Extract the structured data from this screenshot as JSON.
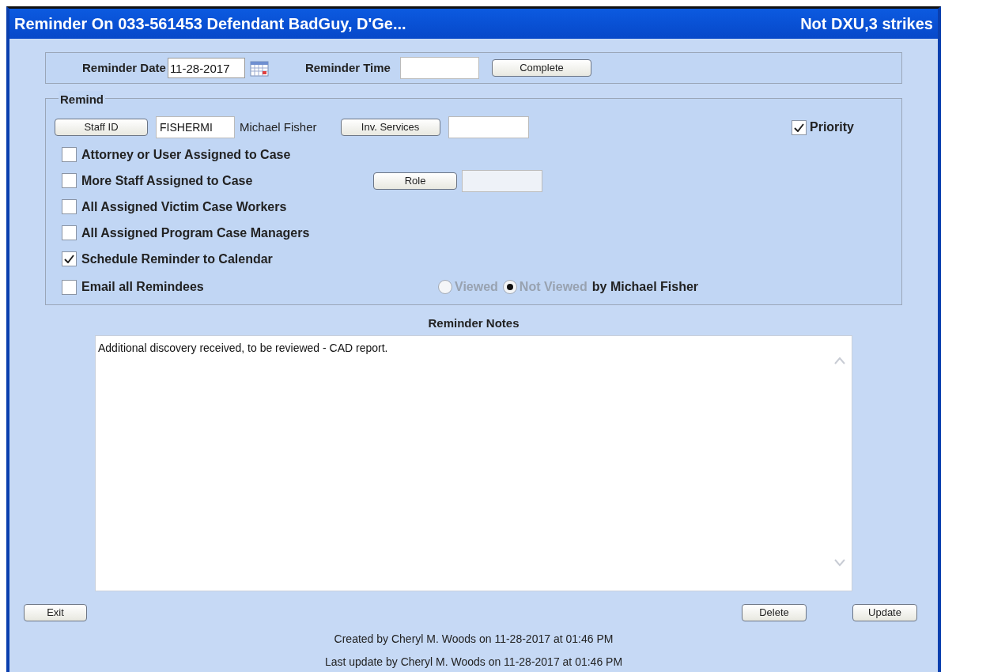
{
  "window": {
    "title": "Reminder On 033-561453 Defendant BadGuy, D'Ge...",
    "flag": "Not DXU,3 strikes"
  },
  "reminder_date": {
    "label": "Reminder Date",
    "value": "11-28-2017"
  },
  "reminder_time": {
    "label": "Reminder Time"
  },
  "complete_button": "Complete",
  "remind": {
    "legend": "Remind",
    "staff_button": "Staff ID",
    "staff_id": "FISHERMI",
    "staff_name": "Michael Fisher",
    "services_button": "Inv. Services",
    "role_button": "Role",
    "priority": {
      "label": "Priority",
      "checked": true
    },
    "options": [
      {
        "label": "Attorney or User Assigned to Case",
        "checked": false
      },
      {
        "label": "More Staff Assigned to Case",
        "checked": false
      },
      {
        "label": "All Assigned Victim Case Workers",
        "checked": false
      },
      {
        "label": "All Assigned Program Case Managers",
        "checked": false
      },
      {
        "label": "Schedule Reminder to Calendar",
        "checked": true
      },
      {
        "label": "Email all Remindees",
        "checked": false
      }
    ],
    "view_status": [
      {
        "label": "Viewed",
        "selected": false,
        "disabled": true
      },
      {
        "label": "Not Viewed",
        "selected": true,
        "disabled": true
      }
    ],
    "view_by": "by Michael Fisher"
  },
  "notes": {
    "label": "Reminder Notes",
    "value": "Additional discovery received, to be reviewed - CAD report."
  },
  "buttons": {
    "exit": "Exit",
    "delete": "Delete",
    "update": "Update"
  },
  "footer": [
    "Created by Cheryl M. Woods on 11-28-2017 at 01:46 PM",
    "Last update by Cheryl M. Woods on 11-28-2017 at 01:46 PM"
  ]
}
